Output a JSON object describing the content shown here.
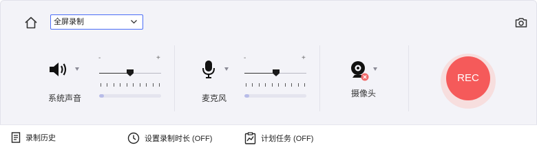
{
  "top": {
    "home_icon": "home-icon",
    "mode_select": {
      "value": "全屏录制",
      "icon": "chevron-down-icon"
    },
    "camera_icon": "camera-icon"
  },
  "devices": [
    {
      "key": "system-audio",
      "icon": "speaker-icon",
      "label": "系统声音",
      "minus": "-",
      "plus": "+",
      "volume": 0.5,
      "level": 0.08
    },
    {
      "key": "microphone",
      "icon": "microphone-icon",
      "label": "麦克风",
      "minus": "-",
      "plus": "+",
      "volume": 0.5,
      "level": 0.08
    },
    {
      "key": "webcam",
      "icon": "webcam-icon",
      "status_icon": "disabled-x-icon",
      "label": "摄像头"
    }
  ],
  "rec_button": {
    "label": "REC",
    "color": "#f55a5a"
  },
  "bottom_bar": [
    {
      "key": "history",
      "icon": "document-list-icon",
      "label": "录制历史"
    },
    {
      "key": "duration",
      "icon": "clock-icon",
      "label": "设置录制时长 (OFF)"
    },
    {
      "key": "schedule",
      "icon": "clipboard-chart-icon",
      "label": "计划任务 (OFF)"
    }
  ]
}
